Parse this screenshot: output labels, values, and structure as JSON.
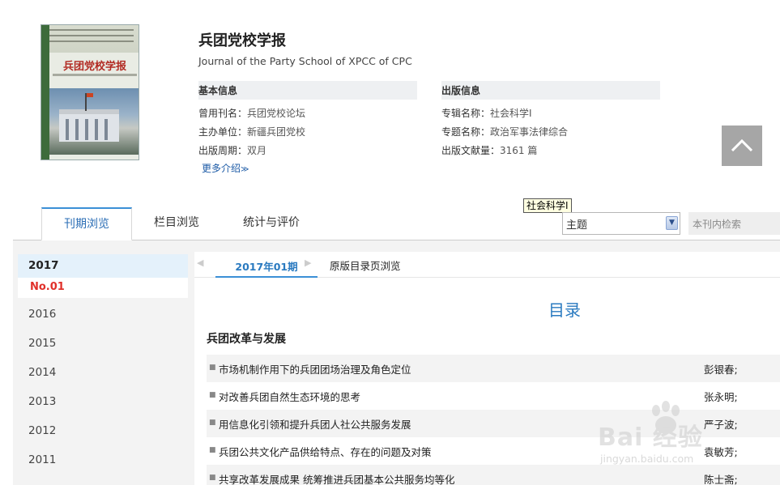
{
  "journal": {
    "title": "兵团党校学报",
    "english_title": "Journal of the Party School of XPCC of CPC",
    "cover_title": "兵团党校学报"
  },
  "basic_info": {
    "heading": "基本信息",
    "former_name_label": "曾用刊名：",
    "former_name": "兵团党校论坛",
    "sponsor_label": "主办单位：",
    "sponsor": "新疆兵团党校",
    "period_label": "出版周期：",
    "period": "双月",
    "more_label": "更多介绍"
  },
  "publish_info": {
    "heading": "出版信息",
    "series_label": "专辑名称：",
    "series": "社会科学I",
    "topic_label": "专题名称：",
    "topic": "政治军事法律综合",
    "count_label": "出版文献量：",
    "count": "3161",
    "count_unit": " 篇"
  },
  "tabs": {
    "issue_browse": "刊期浏览",
    "column_browse": "栏目浏览",
    "stats": "统计与评价"
  },
  "tooltip": "社会科学I",
  "search": {
    "select_value": "主题",
    "placeholder": "本刊内检索"
  },
  "years": {
    "active": "2017",
    "active_issue": "No.01",
    "list": [
      "2016",
      "2015",
      "2014",
      "2013",
      "2012",
      "2011"
    ]
  },
  "issue_nav": {
    "prev": "◀",
    "current": "2017年01期",
    "next": "▶",
    "original_toc": "原版目录页浏览"
  },
  "toc": {
    "heading": "目录",
    "column_title": "兵团改革与发展",
    "articles": [
      {
        "title": "市场机制作用下的兵团团场治理及角色定位",
        "author": "彭银春;"
      },
      {
        "title": "对改善兵团自然生态环境的思考",
        "author": "张永明;"
      },
      {
        "title": "用信息化引领和提升兵团人社公共服务发展",
        "author": "严子波;"
      },
      {
        "title": "兵团公共文化产品供给特点、存在的问题及对策",
        "author": "袁敏芳;"
      },
      {
        "title": "共享改革发展成果 统筹推进兵团基本公共服务均等化",
        "author": "陈士斋;"
      }
    ]
  },
  "watermark": {
    "text": "Bai  经验",
    "url": "jingyan.baidu.com"
  }
}
